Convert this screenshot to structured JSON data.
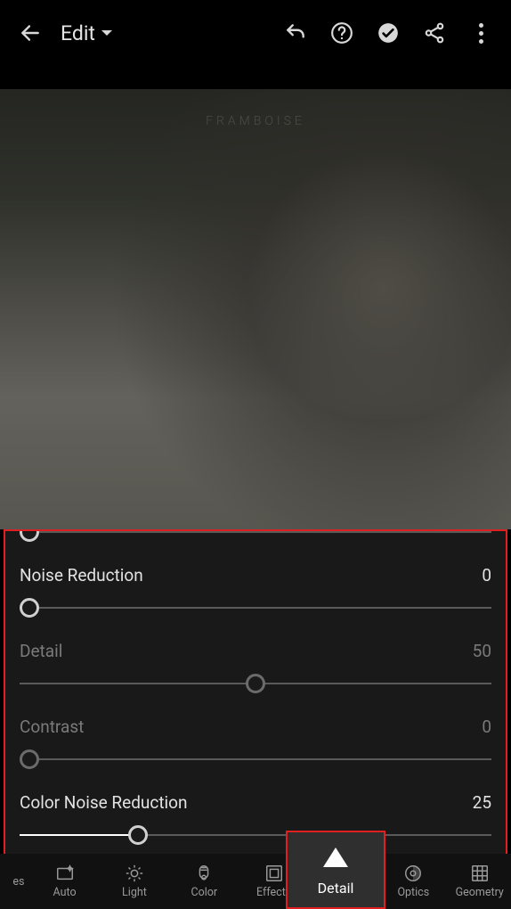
{
  "header": {
    "edit_label": "Edit"
  },
  "photo": {
    "watermark": "FRAMBOISE"
  },
  "sliders": {
    "partial": {
      "value": 0,
      "pct": 0
    },
    "noise_reduction": {
      "label": "Noise Reduction",
      "value": 0,
      "pct": 0
    },
    "detail": {
      "label": "Detail",
      "value": 50,
      "pct": 50
    },
    "contrast": {
      "label": "Contrast",
      "value": 0,
      "pct": 0
    },
    "color_noise": {
      "label": "Color Noise Reduction",
      "value": 25,
      "pct": 25
    }
  },
  "tabs": {
    "presets": "es",
    "auto": "Auto",
    "light": "Light",
    "color": "Color",
    "effects": "Effects",
    "detail": "Detail",
    "optics": "Optics",
    "geometry": "Geometry"
  }
}
